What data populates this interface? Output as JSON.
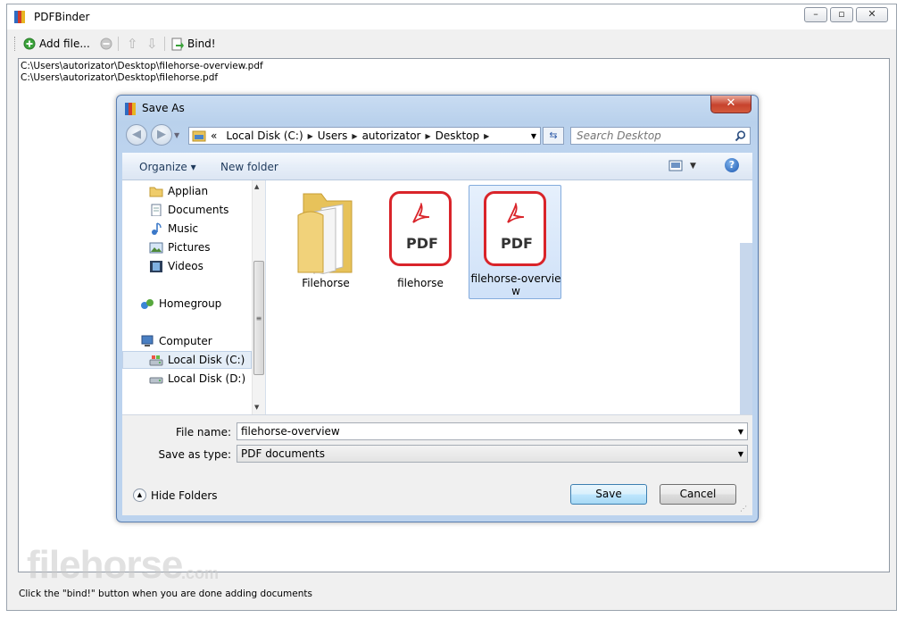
{
  "main_window": {
    "title": "PDFBinder",
    "toolbar": {
      "add_file_label": "Add file...",
      "bind_label": "Bind!"
    },
    "files": [
      "C:\\Users\\autorizator\\Desktop\\filehorse-overview.pdf",
      "C:\\Users\\autorizator\\Desktop\\filehorse.pdf"
    ],
    "status_text": "Click the \"bind!\" button when you are done adding documents"
  },
  "watermark": {
    "brand": "filehorse",
    "suffix": ".com"
  },
  "dialog": {
    "title": "Save As",
    "address": {
      "overflow": "«",
      "crumbs": [
        "Local Disk (C:)",
        "Users",
        "autorizator",
        "Desktop"
      ]
    },
    "search_placeholder": "Search Desktop",
    "command_bar": {
      "organize_label": "Organize ▾",
      "new_folder_label": "New folder"
    },
    "nav_items": [
      {
        "label": "Applian",
        "icon": "folder-icon"
      },
      {
        "label": "Documents",
        "icon": "documents-icon"
      },
      {
        "label": "Music",
        "icon": "music-icon"
      },
      {
        "label": "Pictures",
        "icon": "pictures-icon"
      },
      {
        "label": "Videos",
        "icon": "videos-icon"
      },
      {
        "label": "Homegroup",
        "icon": "homegroup-icon"
      },
      {
        "label": "Computer",
        "icon": "computer-icon"
      },
      {
        "label": "Local Disk (C:)",
        "icon": "drive-icon"
      },
      {
        "label": "Local Disk (D:)",
        "icon": "drive-icon"
      }
    ],
    "files": [
      {
        "label": "Filehorse",
        "type": "folder"
      },
      {
        "label": "filehorse",
        "type": "pdf"
      },
      {
        "label": "filehorse-overvie",
        "label2": "w",
        "type": "pdf"
      }
    ],
    "pdf_icon_text": "PDF",
    "file_name_label": "File name:",
    "file_name_value": "filehorse-overview",
    "save_as_type_label": "Save as type:",
    "save_as_type_value": "PDF documents",
    "hide_folders_label": "Hide Folders",
    "save_label": "Save",
    "cancel_label": "Cancel"
  },
  "colors": {
    "pdf_red": "#d9242a",
    "dialog_frame": "#bcd3ee",
    "selection": "#cfe1f8"
  }
}
